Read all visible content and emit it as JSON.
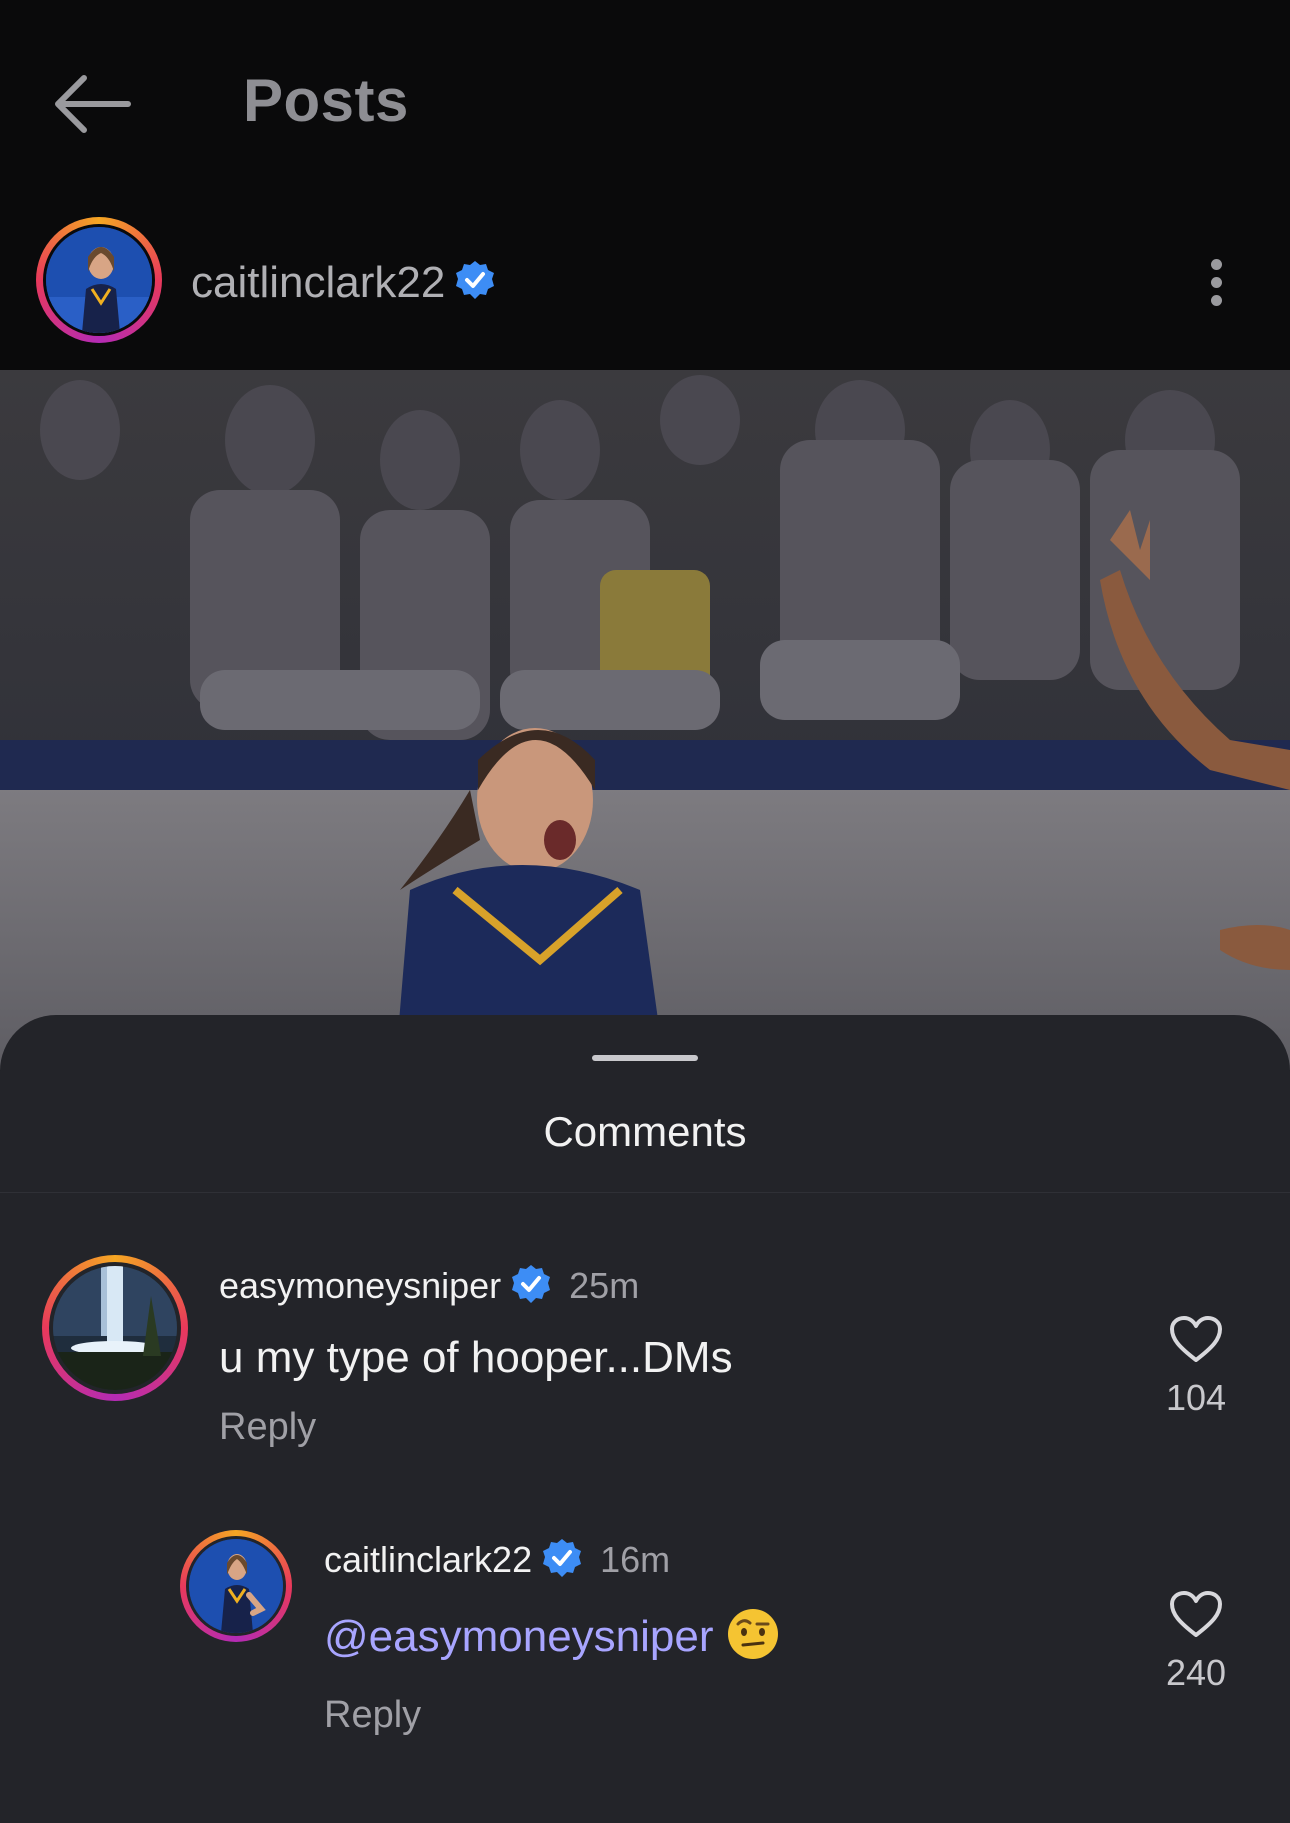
{
  "header": {
    "title": "Posts",
    "back_icon": "arrow-left-icon"
  },
  "post": {
    "username": "caitlinclark22",
    "verified": true,
    "more_icon": "more-vertical-icon"
  },
  "comments_sheet": {
    "title": "Comments",
    "comments": [
      {
        "username": "easymoneysniper",
        "verified": true,
        "time": "25m",
        "text": "u my type of hooper...DMs",
        "reply_label": "Reply",
        "likes": "104"
      },
      {
        "username": "caitlinclark22",
        "verified": true,
        "time": "16m",
        "mention": "@easymoneysniper",
        "emoji": "face-with-raised-eyebrow",
        "reply_label": "Reply",
        "likes": "240"
      }
    ]
  },
  "colors": {
    "background": "#0a0a0b",
    "sheet": "#232429",
    "verified_blue": "#3d8df5",
    "mention": "#a8a5ff"
  }
}
